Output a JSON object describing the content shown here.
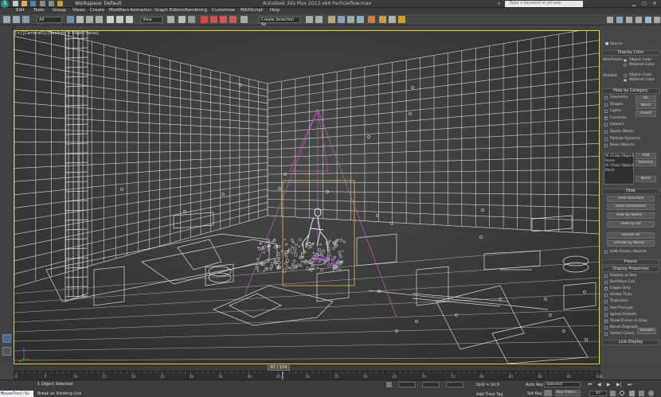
{
  "app": {
    "title": "Autodesk 3ds Max 2013 x64     Particleflow.max",
    "workspace": "Workspace: Default",
    "search_placeholder": "Type a keyword or phrase"
  },
  "menu": {
    "items": [
      "Edit",
      "Tools",
      "Group",
      "Views",
      "Create",
      "Modifiers",
      "Animation",
      "Graph Editors",
      "Rendering",
      "Customize",
      "MAXScript",
      "Help"
    ]
  },
  "toolbar": {
    "selection_filter": "All",
    "reference_coord": "View",
    "named_selection": "Create Selection Se"
  },
  "viewport": {
    "label": "[+] [Camera01] [Realistic + Edged Faces]"
  },
  "panel": {
    "source_label": "Source",
    "display_color": {
      "title": "Display Color",
      "wireframe_label": "Wireframe:",
      "shaded_label": "Shaded:",
      "opt_object": "Object Color",
      "opt_material": "Material Color"
    },
    "hide_by_category": {
      "title": "Hide by Category",
      "items": [
        {
          "label": "Geometry",
          "checked": false
        },
        {
          "label": "Shapes",
          "checked": false
        },
        {
          "label": "Lights",
          "checked": false
        },
        {
          "label": "Cameras",
          "checked": true
        },
        {
          "label": "Helpers",
          "checked": false
        },
        {
          "label": "Space Warps",
          "checked": false
        },
        {
          "label": "Particle Systems",
          "checked": false
        },
        {
          "label": "Bone Objects",
          "checked": false
        }
      ],
      "btn_all": "All",
      "btn_none": "None",
      "btn_invert": "Invert",
      "list": [
        "IK Chain Object",
        "Bone",
        "IK Chain Object",
        "Point"
      ],
      "btn_add": "Add",
      "btn_remove": "Remove",
      "btn_none2": "None"
    },
    "hide": {
      "title": "Hide",
      "buttons": [
        "Hide Selected",
        "Hide Unselected",
        "Hide by Name...",
        "Hide by Hit",
        "Unhide All",
        "Unhide by Name..."
      ],
      "hide_frozen": "Hide Frozen Objects"
    },
    "freeze_title": "Freeze",
    "display_properties": {
      "title": "Display Properties",
      "items": [
        {
          "label": "Display as Box",
          "checked": false
        },
        {
          "label": "Backface Cull",
          "checked": false
        },
        {
          "label": "Edges Only",
          "checked": true
        },
        {
          "label": "Vertex Ticks",
          "checked": false
        },
        {
          "label": "Trajectory",
          "checked": false
        },
        {
          "label": "See-Through",
          "checked": false
        },
        {
          "label": "Ignore Extents",
          "checked": false
        },
        {
          "label": "Show Frozen in Gray",
          "checked": true
        },
        {
          "label": "Never Degrade",
          "checked": false
        },
        {
          "label": "Vertex Colors",
          "checked": false
        }
      ],
      "shaded_btn": "Shaded"
    },
    "link_display_title": "Link Display"
  },
  "timeline": {
    "frame_counter": "87 / 104",
    "ticks": [
      "0",
      "5",
      "10",
      "15",
      "20",
      "25",
      "30",
      "35",
      "40",
      "45",
      "50",
      "55",
      "60",
      "65",
      "70",
      "75",
      "80",
      "85",
      "90",
      "95",
      "100"
    ]
  },
  "status": {
    "maxscript_label": "MouseTool:Sc",
    "selection": "1 Object Selected",
    "prompt": "Break an Existing Link",
    "grid": "Grid = 10.0",
    "add_time_tag": "Add Time Tag",
    "auto_key": "Auto Key",
    "set_key": "Set Key",
    "key_mode_value": "Selected",
    "key_filters": "Key Filters...",
    "frame_value": "87"
  },
  "colors": {
    "viewport_bg": "#3a3a3a",
    "wire": "#d4d4d4",
    "active_border": "#e8d94a",
    "camera": "#c060c0"
  }
}
